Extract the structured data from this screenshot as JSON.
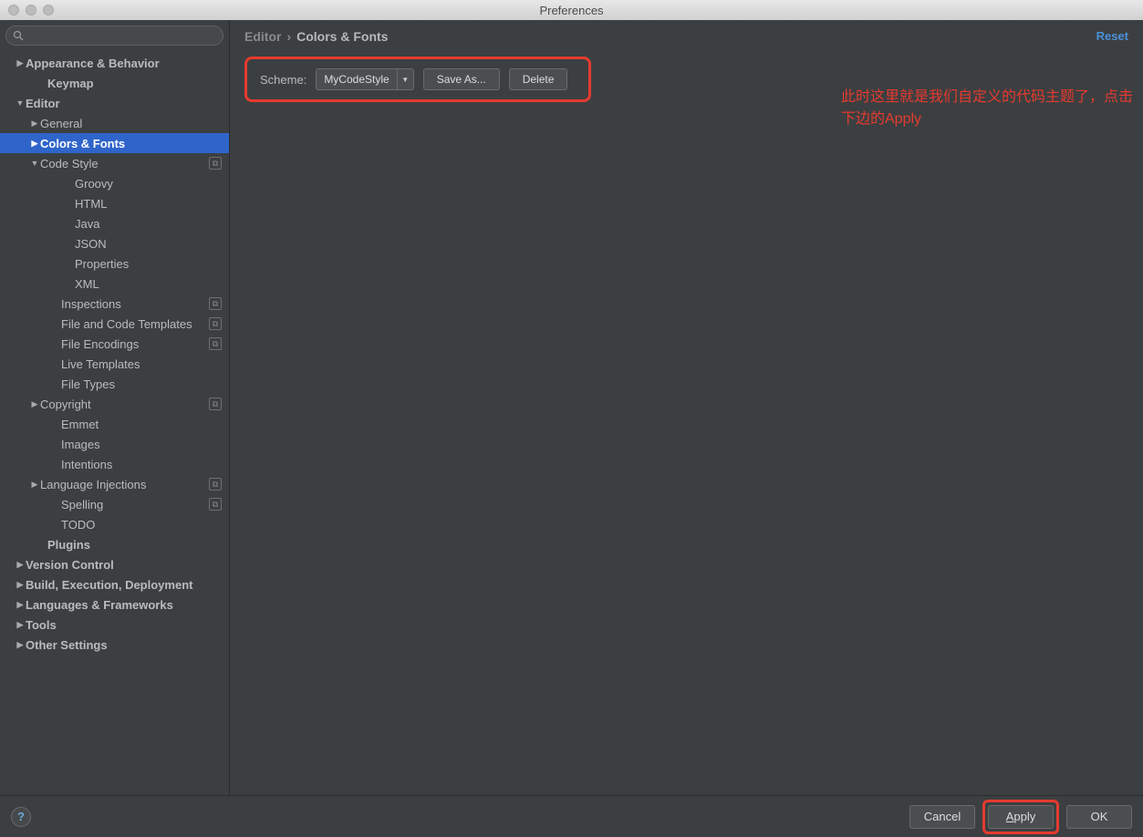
{
  "title": "Preferences",
  "search_placeholder": "",
  "breadcrumb": {
    "root": "Editor",
    "sep": "›",
    "leaf": "Colors & Fonts"
  },
  "reset_label": "Reset",
  "scheme": {
    "label": "Scheme:",
    "value": "MyCodeStyle",
    "save_as": "Save As...",
    "delete": "Delete"
  },
  "annotation_text": "此时这里就是我们自定义的代码主题了，点击下边的Apply",
  "tree": [
    {
      "label": "Appearance & Behavior",
      "tri": "▶",
      "bold": true,
      "pad": 16
    },
    {
      "label": "Keymap",
      "tri": "",
      "bold": true,
      "pad": 40
    },
    {
      "label": "Editor",
      "tri": "▼",
      "bold": true,
      "pad": 16
    },
    {
      "label": "General",
      "tri": "▶",
      "bold": false,
      "pad": 32
    },
    {
      "label": "Colors & Fonts",
      "tri": "▶",
      "bold": true,
      "pad": 32,
      "selected": true
    },
    {
      "label": "Code Style",
      "tri": "▼",
      "bold": false,
      "pad": 32,
      "badge": true
    },
    {
      "label": "Groovy",
      "tri": "",
      "bold": false,
      "pad": 70
    },
    {
      "label": "HTML",
      "tri": "",
      "bold": false,
      "pad": 70
    },
    {
      "label": "Java",
      "tri": "",
      "bold": false,
      "pad": 70
    },
    {
      "label": "JSON",
      "tri": "",
      "bold": false,
      "pad": 70
    },
    {
      "label": "Properties",
      "tri": "",
      "bold": false,
      "pad": 70
    },
    {
      "label": "XML",
      "tri": "",
      "bold": false,
      "pad": 70
    },
    {
      "label": "Inspections",
      "tri": "",
      "bold": false,
      "pad": 55,
      "badge": true
    },
    {
      "label": "File and Code Templates",
      "tri": "",
      "bold": false,
      "pad": 55,
      "badge": true
    },
    {
      "label": "File Encodings",
      "tri": "",
      "bold": false,
      "pad": 55,
      "badge": true
    },
    {
      "label": "Live Templates",
      "tri": "",
      "bold": false,
      "pad": 55
    },
    {
      "label": "File Types",
      "tri": "",
      "bold": false,
      "pad": 55
    },
    {
      "label": "Copyright",
      "tri": "▶",
      "bold": false,
      "pad": 32,
      "badge": true
    },
    {
      "label": "Emmet",
      "tri": "",
      "bold": false,
      "pad": 55
    },
    {
      "label": "Images",
      "tri": "",
      "bold": false,
      "pad": 55
    },
    {
      "label": "Intentions",
      "tri": "",
      "bold": false,
      "pad": 55
    },
    {
      "label": "Language Injections",
      "tri": "▶",
      "bold": false,
      "pad": 32,
      "badge": true
    },
    {
      "label": "Spelling",
      "tri": "",
      "bold": false,
      "pad": 55,
      "badge": true
    },
    {
      "label": "TODO",
      "tri": "",
      "bold": false,
      "pad": 55
    },
    {
      "label": "Plugins",
      "tri": "",
      "bold": true,
      "pad": 40
    },
    {
      "label": "Version Control",
      "tri": "▶",
      "bold": true,
      "pad": 16
    },
    {
      "label": "Build, Execution, Deployment",
      "tri": "▶",
      "bold": true,
      "pad": 16
    },
    {
      "label": "Languages & Frameworks",
      "tri": "▶",
      "bold": true,
      "pad": 16
    },
    {
      "label": "Tools",
      "tri": "▶",
      "bold": true,
      "pad": 16
    },
    {
      "label": "Other Settings",
      "tri": "▶",
      "bold": true,
      "pad": 16
    }
  ],
  "footer": {
    "help": "?",
    "cancel": "Cancel",
    "apply": "Apply",
    "ok": "OK"
  }
}
